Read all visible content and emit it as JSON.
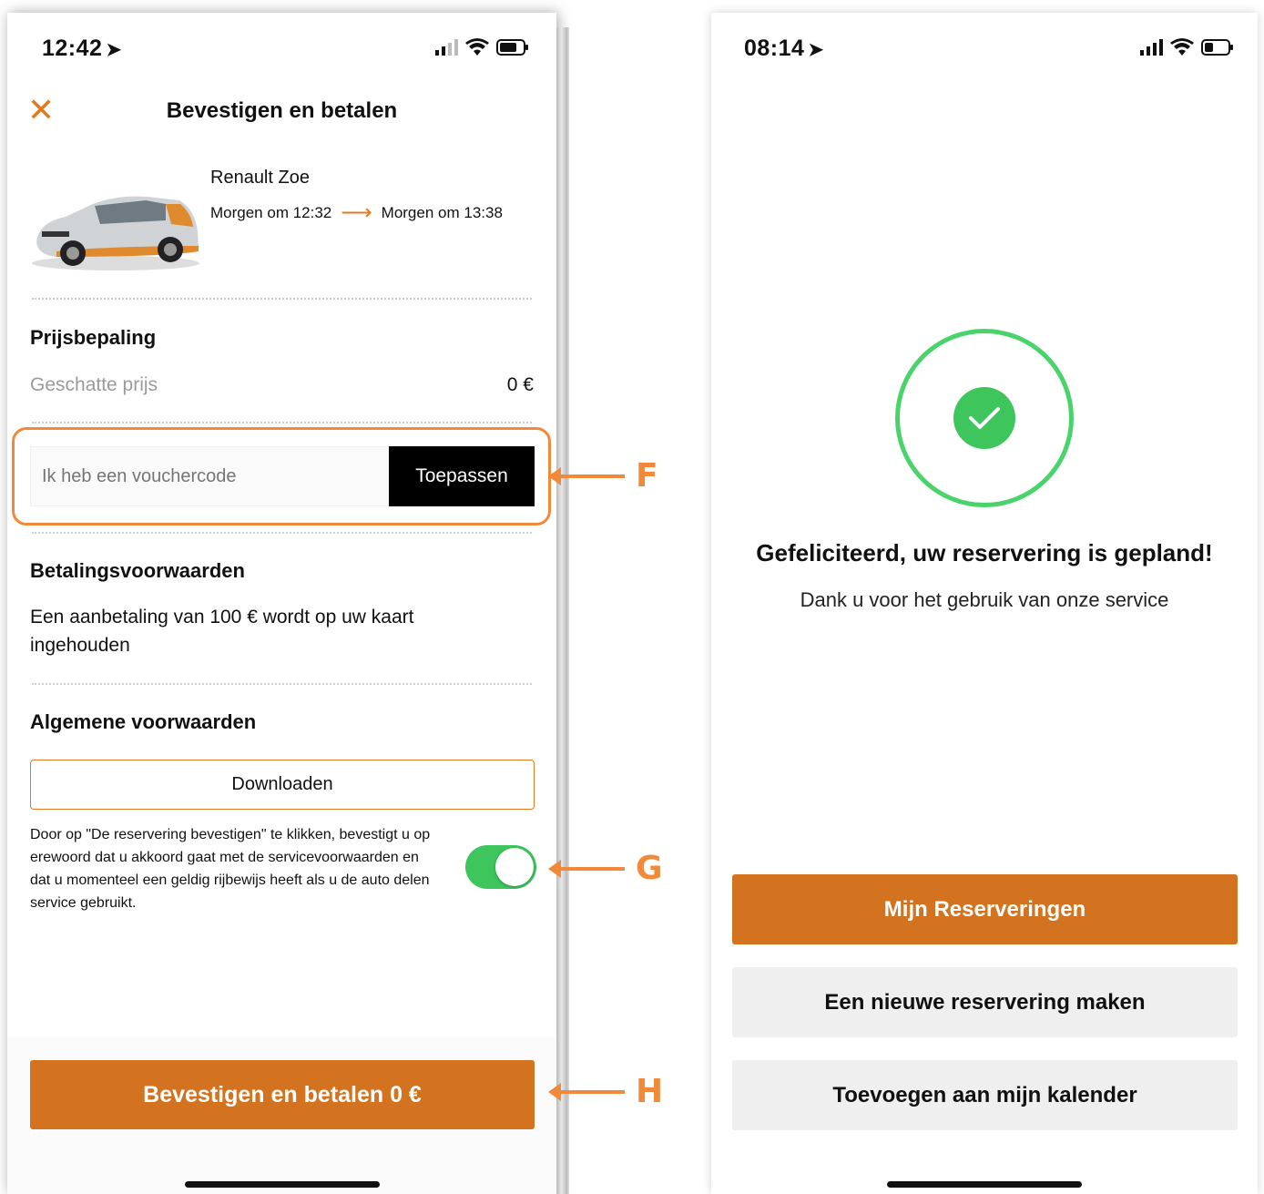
{
  "colors": {
    "accent": "#d4731f",
    "annotation": "#f08a3a",
    "success": "#3ec55c",
    "dark_button": "#000000"
  },
  "left_screen": {
    "status_time": "12:42",
    "title": "Bevestigen en betalen",
    "car": {
      "model": "Renault Zoe",
      "start": "Morgen om 12:32",
      "end": "Morgen om 13:38"
    },
    "pricing": {
      "heading": "Prijsbepaling",
      "estimate_label": "Geschatte prijs",
      "estimate_value": "0 €"
    },
    "voucher": {
      "placeholder": "Ik heb een vouchercode",
      "apply_label": "Toepassen"
    },
    "payment_terms": {
      "heading": "Betalingsvoorwaarden",
      "text": "Een aanbetaling van 100 € wordt op uw kaart ingehouden"
    },
    "general_terms": {
      "heading": "Algemene voorwaarden",
      "download_label": "Downloaden",
      "legal": "Door op \"De reservering bevestigen\" te klikken, bevestigt u op erewoord dat u akkoord gaat met de servicevoorwaarden en dat u momenteel een geldig rijbewijs heeft als u de auto delen service gebruikt.",
      "toggle_on": true
    },
    "pay_button": "Bevestigen en betalen 0 €"
  },
  "annotations": {
    "f": "F",
    "g": "G",
    "h": "H"
  },
  "right_screen": {
    "status_time": "08:14",
    "title": "Gefeliciteerd, uw reservering is gepland!",
    "subtitle": "Dank u voor het gebruik van onze service",
    "buttons": {
      "my_reservations": "Mijn Reserveringen",
      "new_reservation": "Een nieuwe reservering maken",
      "add_calendar": "Toevoegen aan mijn kalender"
    }
  }
}
